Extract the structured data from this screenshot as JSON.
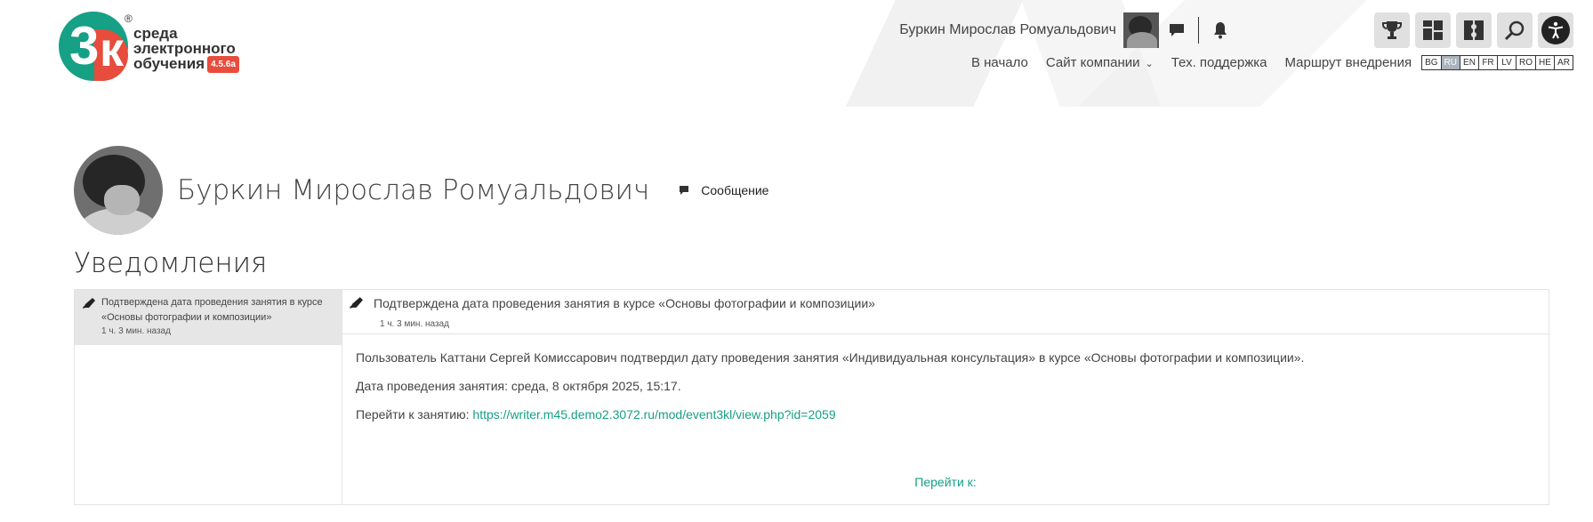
{
  "logo": {
    "reg": "®",
    "line1": "среда",
    "line2": "электронного",
    "line3": "обучения",
    "version": "4.5.6a"
  },
  "userbar": {
    "user_name": "Буркин Мирослав Ромуальдович"
  },
  "nav": {
    "home": "В начало",
    "company_site": "Сайт компании",
    "support": "Тех. поддержка",
    "route": "Маршрут внедрения",
    "languages": [
      "BG",
      "RU",
      "EN",
      "FR",
      "LV",
      "RO",
      "HE",
      "AR"
    ],
    "active_language": "RU"
  },
  "profile": {
    "name": "Буркин Мирослав Ромуальдович",
    "message_label": "Сообщение"
  },
  "page": {
    "title": "Уведомления"
  },
  "notifications": {
    "list": [
      {
        "text": "Подтверждена дата проведения занятия в курсе «Основы фотографии и композиции»",
        "time": "1 ч. 3 мин. назад"
      }
    ],
    "detail": {
      "title": "Подтверждена дата проведения занятия в курсе «Основы фотографии и композиции»",
      "time": "1 ч. 3 мин. назад",
      "body1": "Пользователь Каттани Сергей Комиссарович подтвердил дату проведения занятия «Индивидуальная консультация» в курсе «Основы фотографии и композиции».",
      "body2": "Дата проведения занятия: среда, 8 октября 2025, 15:17.",
      "body3_prefix": "Перейти к занятию: ",
      "link": "https://writer.m45.demo2.3072.ru/mod/event3kl/view.php?id=2059",
      "goto": "Перейти к:"
    }
  },
  "colors": {
    "accent": "#16a085",
    "brand_red": "#e74c3c",
    "active_lang_bg": "#a9b4bd"
  }
}
